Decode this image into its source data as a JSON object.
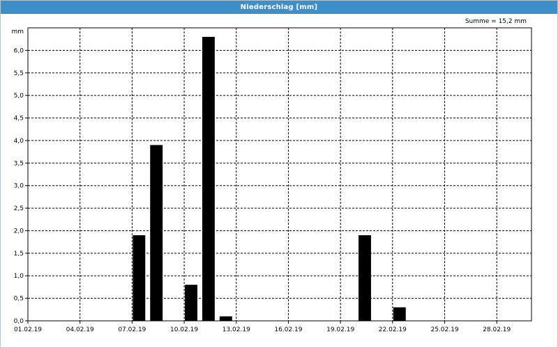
{
  "window": {
    "title": "Niederschlag [mm]"
  },
  "summary": {
    "text": "Summe = 15,2 mm"
  },
  "chart_data": {
    "type": "bar",
    "ylabel": "mm",
    "ylim": [
      0,
      6.5
    ],
    "yticks": [
      0,
      0.5,
      1.0,
      1.5,
      2.0,
      2.5,
      3.0,
      3.5,
      4.0,
      4.5,
      5.0,
      5.5,
      6.0
    ],
    "ytick_labels": [
      "0,0",
      "0,5",
      "1,0",
      "1,5",
      "2,0",
      "2,5",
      "3,0",
      "3,5",
      "4,0",
      "4,5",
      "5,0",
      "5,5",
      "6,0"
    ],
    "xlim": [
      "01.02.19",
      "02.03.19"
    ],
    "xtick_labels": [
      "01.02.19",
      "04.02.19",
      "07.02.19",
      "10.02.19",
      "13.02.19",
      "16.02.19",
      "19.02.19",
      "22.02.19",
      "25.02.19",
      "28.02.19"
    ],
    "grid": true,
    "x": [
      "07.02.19",
      "08.02.19",
      "10.02.19",
      "11.02.19",
      "12.02.19",
      "20.02.19",
      "22.02.19"
    ],
    "values": [
      1.9,
      3.9,
      0.8,
      6.3,
      0.1,
      1.9,
      0.3
    ],
    "bar_color": "#000000"
  }
}
